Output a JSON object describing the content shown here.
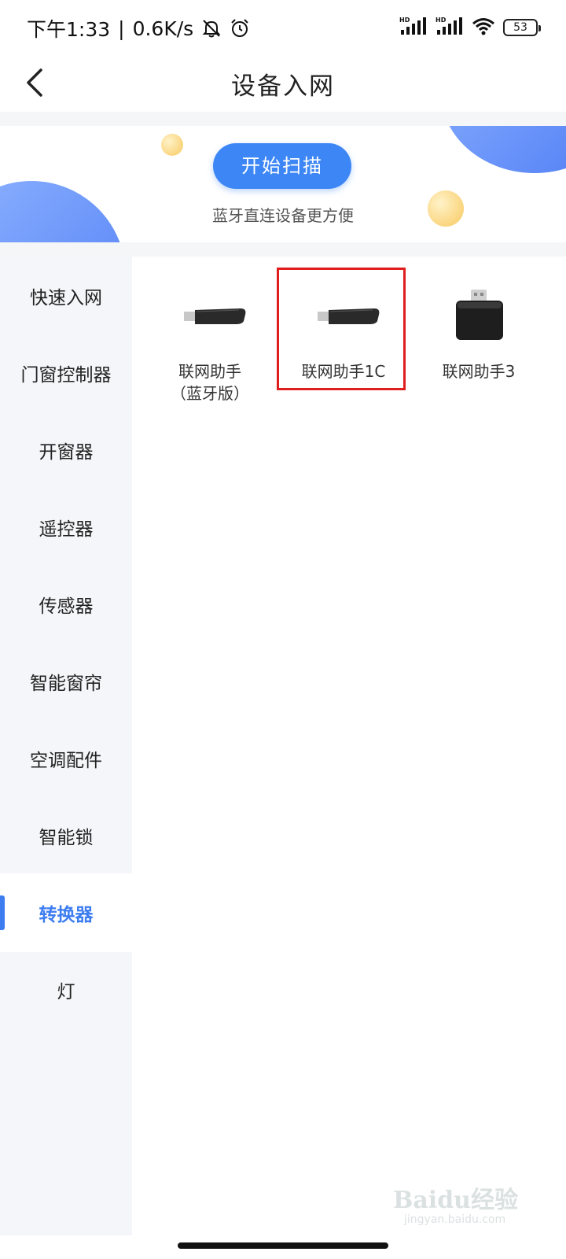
{
  "status_bar": {
    "time": "下午1:33",
    "separator": "|",
    "speed": "0.6K/s",
    "icons": [
      "bell-off-icon",
      "alarm-icon",
      "hd-signal-icon",
      "hd-signal-icon",
      "wifi-icon"
    ],
    "hd_label": "HD",
    "battery": "53"
  },
  "header": {
    "title": "设备入网",
    "back_icon": "back-chevron-icon"
  },
  "banner": {
    "scan_button": "开始扫描",
    "subtitle": "蓝牙直连设备更方便"
  },
  "sidebar": {
    "items": [
      {
        "label": "快速入网",
        "active": false
      },
      {
        "label": "门窗控制器",
        "active": false
      },
      {
        "label": "开窗器",
        "active": false
      },
      {
        "label": "遥控器",
        "active": false
      },
      {
        "label": "传感器",
        "active": false
      },
      {
        "label": "智能窗帘",
        "active": false
      },
      {
        "label": "空调配件",
        "active": false
      },
      {
        "label": "智能锁",
        "active": false
      },
      {
        "label": "转换器",
        "active": true
      },
      {
        "label": "灯",
        "active": false
      }
    ]
  },
  "devices": [
    {
      "line1": "联网助手",
      "line2": "（蓝牙版）",
      "icon": "usb-dongle-icon"
    },
    {
      "line1": "联网助手1C",
      "line2": "",
      "icon": "usb-dongle-icon",
      "highlighted": true
    },
    {
      "line1": "联网助手3",
      "line2": "",
      "icon": "usb-hub-icon"
    }
  ],
  "watermark": {
    "brand": "Baidu经验",
    "sub": "jingyan.baidu.com"
  },
  "colors": {
    "accent": "#3d86f5",
    "active_text": "#3d7df0",
    "highlight_border": "#e01e1e",
    "sidebar_bg": "#f5f6fa"
  }
}
